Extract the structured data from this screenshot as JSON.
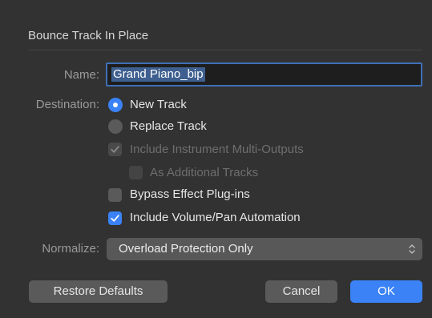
{
  "dialog": {
    "title": "Bounce Track In Place"
  },
  "name": {
    "label": "Name:",
    "value": "Grand Piano_bip"
  },
  "destination": {
    "label": "Destination:",
    "options": [
      {
        "label": "New Track",
        "selected": true
      },
      {
        "label": "Replace Track",
        "selected": false
      }
    ]
  },
  "options": {
    "include_instrument_multi_outputs": {
      "label": "Include Instrument Multi-Outputs",
      "checked": true,
      "enabled": false
    },
    "as_additional_tracks": {
      "label": "As Additional Tracks",
      "checked": false,
      "enabled": false
    },
    "bypass_effect_plugins": {
      "label": "Bypass Effect Plug-ins",
      "checked": false,
      "enabled": true
    },
    "include_volume_pan_automation": {
      "label": "Include Volume/Pan Automation",
      "checked": true,
      "enabled": true
    }
  },
  "normalize": {
    "label": "Normalize:",
    "selected": "Overload Protection Only"
  },
  "buttons": {
    "restore_defaults": "Restore Defaults",
    "cancel": "Cancel",
    "ok": "OK"
  },
  "colors": {
    "accent": "#3a82f6",
    "background": "#323232",
    "control": "#5a5a5a"
  }
}
